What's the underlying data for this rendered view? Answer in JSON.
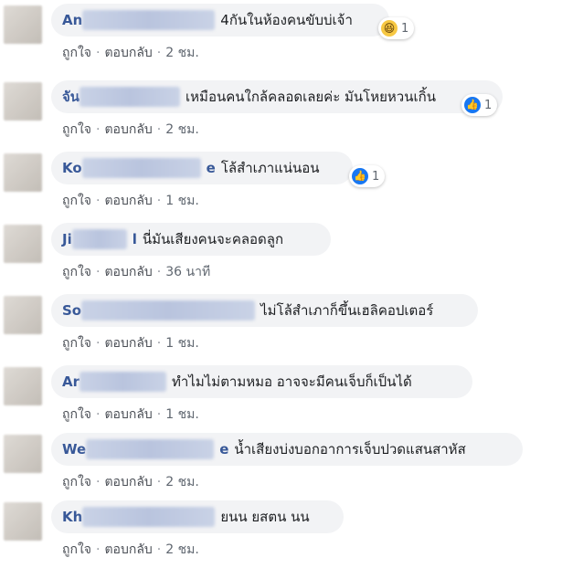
{
  "comments": [
    {
      "author_visible": "An",
      "text": "4กันในห้องคนขับบ่เจ้า",
      "reaction": {
        "icon": "haha-icon",
        "count": "1"
      },
      "like": "ถูกใจ",
      "reply": "ตอบกลับ",
      "time": "2 ชม."
    },
    {
      "author_visible": "จัน",
      "text": "เหมือนคนใกล้คลอดเลยค่ะ มันโหยหวนเกิ้น",
      "reaction": {
        "icon": "like-icon",
        "count": "1"
      },
      "like": "ถูกใจ",
      "reply": "ตอบกลับ",
      "time": "2 ชม."
    },
    {
      "author_visible": "Ko",
      "author_suffix": "e",
      "text": "โล้สำเภาแน่นอน",
      "reaction": {
        "icon": "like-icon",
        "count": "1"
      },
      "like": "ถูกใจ",
      "reply": "ตอบกลับ",
      "time": "1 ชม."
    },
    {
      "author_visible": "Ji",
      "author_suffix": "l",
      "text": "นี่มันเสียงคนจะคลอดลูก",
      "reaction": null,
      "like": "ถูกใจ",
      "reply": "ตอบกลับ",
      "time": "36 นาที"
    },
    {
      "author_visible": "So",
      "text": "ไม่โล้สำเภาก็ขึ้นเฮลิคอปเตอร์",
      "reaction": null,
      "like": "ถูกใจ",
      "reply": "ตอบกลับ",
      "time": "1 ชม."
    },
    {
      "author_visible": "Ar",
      "text": "ทำไมไม่ตามหมอ อาจจะมีคนเจ็บก็เป็นได้",
      "reaction": null,
      "like": "ถูกใจ",
      "reply": "ตอบกลับ",
      "time": "1 ชม."
    },
    {
      "author_visible": "We",
      "author_suffix": "e",
      "text": "น้ำเสียงบ่งบอกอาการเจ็บปวดแสนสาหัส",
      "reaction": null,
      "like": "ถูกใจ",
      "reply": "ตอบกลับ",
      "time": "2 ชม."
    },
    {
      "author_visible": "Kh",
      "text": "ยนน ยสตน นน",
      "reaction": null,
      "like": "ถูกใจ",
      "reply": "ตอบกลับ",
      "time": "2 ชม."
    }
  ],
  "colors": {
    "author": "#385898",
    "bubble": "#f2f3f5",
    "meta": "#606770",
    "like_blue": "#1877f2"
  }
}
